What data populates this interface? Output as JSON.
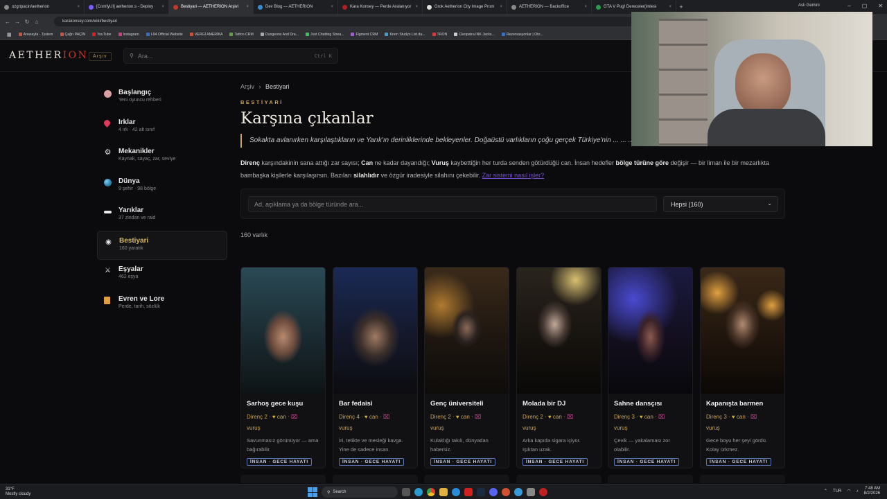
{
  "browser": {
    "tabs": [
      {
        "label": "ozgripacin/aetherion",
        "active": false
      },
      {
        "label": "[ComfyUI] aetherion.s - Deploy",
        "active": false
      },
      {
        "label": "Bestiyari — AETHERION Arşivi",
        "active": true
      },
      {
        "label": "Dev Blog — AETHERION",
        "active": false
      },
      {
        "label": "Kara Konsey — Perde Aralanıyor",
        "active": false
      },
      {
        "label": "Grok Aetherion City Image Prom",
        "active": false
      },
      {
        "label": "AETHERION — Backoffice",
        "active": false
      },
      {
        "label": "GTA V Pug! Dereceler(imlesi",
        "active": false
      }
    ],
    "profile": "Aslı Gemini",
    "url": "karakonsey.com/wiki/bestiyari",
    "bookmarks": [
      "Anasayfa - Tystem",
      "Çağrı PAÇİN",
      "YouTube",
      "Instagram",
      "I-94 Official Website",
      "VERGİ AMERİKA",
      "Tattoo CRM",
      "Dungeons And Dra...",
      "Just Chatting Strea...",
      "Figment CRM",
      "Krem Studyo List.da...",
      "TRON",
      "Cleopatra INK Jacks...",
      "Rezervasyonlar | Oto..."
    ]
  },
  "header": {
    "logo_main": "AETHER",
    "logo_accent": "ION",
    "badge": "Arşiv",
    "search_placeholder": "Ara...",
    "search_shortcut": "Ctrl K"
  },
  "sidebar": {
    "items": [
      {
        "title": "Başlangıç",
        "subtitle": "Yeni oyuncu rehberi",
        "active": false,
        "icon": "compass-icon",
        "color": "#d9a0a0"
      },
      {
        "title": "Irklar",
        "subtitle": "4 ırk · 42 alt sınıf",
        "active": false,
        "icon": "blood-drop-icon",
        "color": "#e03a5a"
      },
      {
        "title": "Mekanikler",
        "subtitle": "Kaynak, sayaç, zar, seviye",
        "active": false,
        "icon": "gear-icon",
        "color": "#dcdcdc"
      },
      {
        "title": "Dünya",
        "subtitle": "9 şehir · 98 bölge",
        "active": false,
        "icon": "globe-icon",
        "color": "#3fa7d8"
      },
      {
        "title": "Yarıklar",
        "subtitle": "37 zindan ve raid",
        "active": false,
        "icon": "rift-icon",
        "color": "#e8e8e8"
      },
      {
        "title": "Bestiyari",
        "subtitle": "160 yaratık",
        "active": true,
        "icon": "eye-icon",
        "color": "#e8e8e8"
      },
      {
        "title": "Eşyalar",
        "subtitle": "462 eşya",
        "active": false,
        "icon": "crossed-swords-icon",
        "color": "#e8e8e8"
      },
      {
        "title": "Evren ve Lore",
        "subtitle": "Perde, tarih, sözlük",
        "active": false,
        "icon": "book-icon",
        "color": "#e0a040"
      }
    ]
  },
  "main": {
    "breadcrumb": [
      "Arşiv",
      "Bestiyari"
    ],
    "eyebrow": "BESTİYARİ",
    "title": "Karşına çıkanlar",
    "quote": "Sokakta avlanırken karşılaştıkların ve Yarık'ın derinliklerinde bekleyenler. Doğaüstü varlıkların çoğu gerçek Türkiye'nin ... ... ... Perde inceldikçe sokağa daha çoğu sızıyor.",
    "para": {
      "t1": "Direnç",
      "t2": " karşındakinin sana attığı zar sayısı; ",
      "t3": "Can",
      "t4": " ne kadar dayandığı; ",
      "t5": "Vuruş",
      "t6": " kaybettiğin her turda senden götürdüğü can. İnsan hedefler ",
      "t7": "bölge türüne göre",
      "t8": " değişir — bir liman ile bir mezarlıkta bambaşka kişilerle karşılaşırsın. Bazıları ",
      "t9": "silahlıdır",
      "t10": " ve özgür iradesiyle silahını çekebilir. ",
      "link": "Zar sistemi nasıl işler?"
    },
    "filter_placeholder": "Ad, açıklama ya da bölge türünde ara...",
    "filter_select": "Hepsi (160)",
    "count": "160 varlık",
    "cards": [
      {
        "name": "Sarhoş gece kuşu",
        "direnc": "Direnç 2 ·",
        "can": "can ·",
        "vurus": "vuruş",
        "desc": "Savunmasız görünüyor — ama bağırabilir.",
        "tag": "İNSAN · GECE HAYATI"
      },
      {
        "name": "Bar fedaisi",
        "direnc": "Direnç 4 ·",
        "can": "can ·",
        "vurus": "vuruş",
        "desc": "İri, tetikte ve mesleği kavga. Yine de sadece insan.",
        "tag": "İNSAN · GECE HAYATI"
      },
      {
        "name": "Genç üniversiteli",
        "direnc": "Direnç 2 ·",
        "can": "can ·",
        "vurus": "vuruş",
        "desc": "Kulaklığı takılı, dünyadan habersiz.",
        "tag": "İNSAN · GECE HAYATI"
      },
      {
        "name": "Molada bir DJ",
        "direnc": "Direnç 2 ·",
        "can": "can ·",
        "vurus": "vuruş",
        "desc": "Arka kapıda sigara içiyor. Işıktan uzak.",
        "tag": "İNSAN · GECE HAYATI"
      },
      {
        "name": "Sahne dansçısı",
        "direnc": "Direnç 3 ·",
        "can": "can ·",
        "vurus": "vuruş",
        "desc": "Çevik — yakalaması zor olabilir.",
        "tag": "İNSAN · GECE HAYATI"
      },
      {
        "name": "Kapanışta barmen",
        "direnc": "Direnç 3 ·",
        "can": "can ·",
        "vurus": "vuruş",
        "desc": "Gece boyu her şeyi gördü. Kolay ürkmez.",
        "tag": "İNSAN · GECE HAYATI"
      }
    ]
  },
  "taskbar": {
    "weather_temp": "31°F",
    "weather_text": "Mostly cloudy",
    "search": "Search",
    "lang": "TUR",
    "time": "7:48 AM",
    "date": "8/2/2026"
  }
}
